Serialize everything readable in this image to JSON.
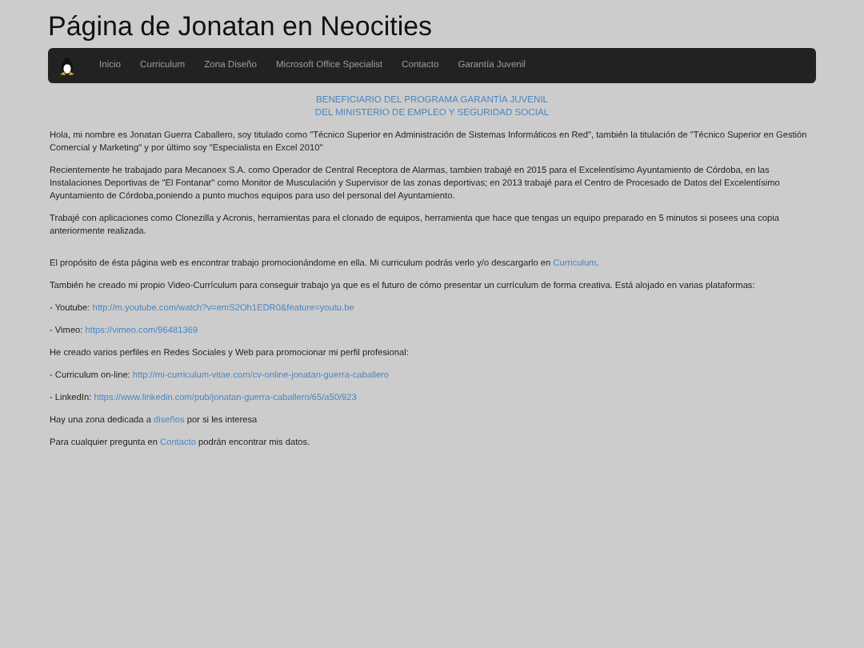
{
  "title": "Página de Jonatan en Neocities",
  "nav": {
    "items": [
      {
        "label": "Inicio"
      },
      {
        "label": "Curriculum"
      },
      {
        "label": "Zona Diseño"
      },
      {
        "label": "Microsoft Office Specialist"
      },
      {
        "label": "Contacto"
      },
      {
        "label": "Garantía Juvenil"
      }
    ]
  },
  "banner": [
    "BENEFICIARIO DEL PROGRAMA GARANTÍA JUVENIL",
    "DEL MINISTERIO DE EMPLEO Y SEGURIDAD SOCIAL"
  ],
  "paragraphs": [
    {
      "parts": [
        {
          "kind": "text",
          "text": "Hola, mi nombre es Jonatan Guerra Caballero, soy titulado como \"Técnico Superior en Administración de Sistemas Informáticos en Red\", también la titulación de \"Técnico Superior en Gestión Comercial y Marketing\" y por último soy \"Especialista en Excel 2010\""
        }
      ]
    },
    {
      "parts": [
        {
          "kind": "text",
          "text": "Recientemente he trabajado para Mecanoex S.A. como Operador de Central Receptora de Alarmas, tambien trabajé en 2015 para el Excelentísimo Ayuntamiento de Córdoba, en las Instalaciones Deportivas de \"El Fontanar\" como Monitor de Musculación y Supervisor de las zonas deportivas; en 2013 trabajé para el Centro de Procesado de Datos del Excelentísimo Ayuntamiento de Córdoba,poniendo a punto muchos equipos para uso del personal del Ayuntamiento."
        }
      ]
    },
    {
      "parts": [
        {
          "kind": "text",
          "text": "Trabajé con aplicaciones como Clonezilla y Acronis, herramientas para el clonado de equipos, herramienta que hace que tengas un equipo preparado en 5 minutos si posees una copia anteriormente realizada."
        }
      ]
    },
    {
      "parts": [
        {
          "kind": "text",
          "text": "El propósito de ésta página web es encontrar trabajo promocionándome en ella. Mi curriculum podrás verlo y/o descargarlo en "
        },
        {
          "kind": "link",
          "text": "Curriculum"
        },
        {
          "kind": "text",
          "text": "."
        }
      ]
    },
    {
      "parts": [
        {
          "kind": "text",
          "text": "También he creado mi propio Video-Currículum para conseguir trabajo ya que es el futuro de cómo presentar un currículum de forma creativa. Está alojado en varias plataformas:"
        }
      ]
    },
    {
      "parts": [
        {
          "kind": "text",
          "text": "- Youtube: "
        },
        {
          "kind": "link",
          "text": "http://m.youtube.com/watch?v=emS2Oh1EDR0&feature=youtu.be"
        }
      ]
    },
    {
      "parts": [
        {
          "kind": "text",
          "text": "- Vimeo: "
        },
        {
          "kind": "link",
          "text": "https://vimeo.com/96481369"
        }
      ]
    },
    {
      "parts": [
        {
          "kind": "text",
          "text": "He creado varios perfiles en Redes Sociales y Web para promocionar mi perfil profesional:"
        }
      ]
    },
    {
      "parts": [
        {
          "kind": "text",
          "text": "- Curriculum on-line: "
        },
        {
          "kind": "link",
          "text": "http://mi-curriculum-vitae.com/cv-online-jonatan-guerra-caballero"
        }
      ]
    },
    {
      "parts": [
        {
          "kind": "text",
          "text": "- LinkedIn: "
        },
        {
          "kind": "link",
          "text": "https://www.linkedin.com/pub/jonatan-guerra-caballero/65/a50/923"
        }
      ]
    },
    {
      "parts": [
        {
          "kind": "text",
          "text": "Hay una zona dedicada a "
        },
        {
          "kind": "link",
          "text": "diseños"
        },
        {
          "kind": "text",
          "text": " por si les interesa"
        }
      ]
    },
    {
      "parts": [
        {
          "kind": "text",
          "text": "Para cualquier pregunta en "
        },
        {
          "kind": "link",
          "text": "Contacto"
        },
        {
          "kind": "text",
          "text": " podrán encontrar mis datos."
        }
      ]
    }
  ]
}
